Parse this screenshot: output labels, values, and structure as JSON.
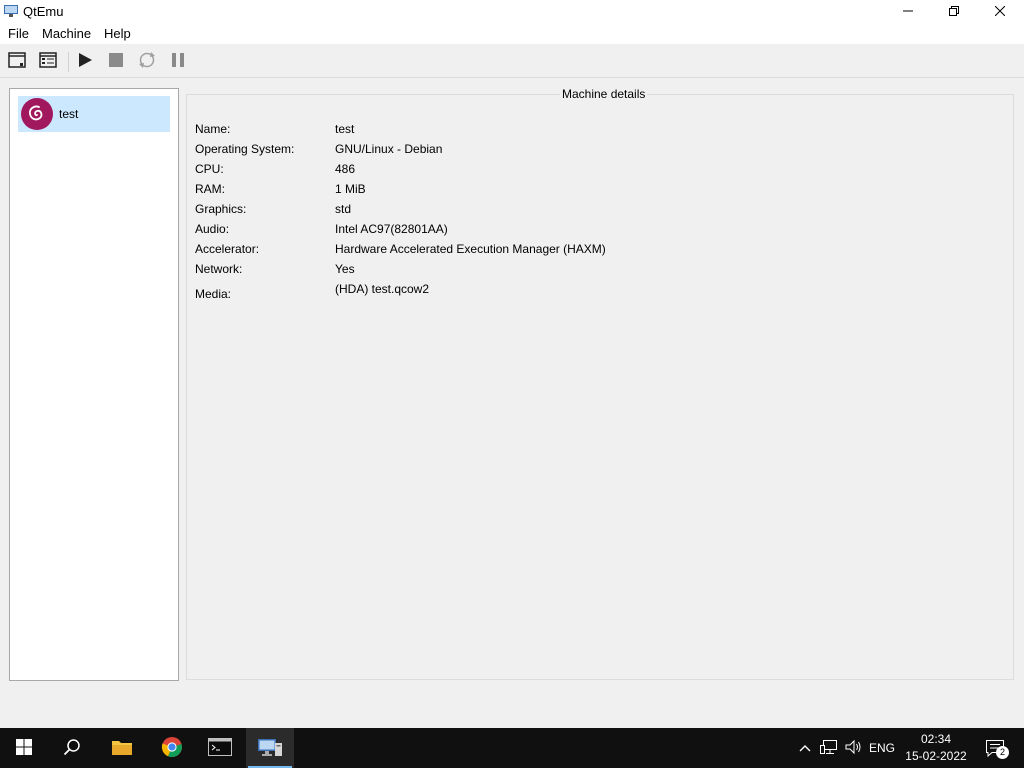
{
  "window": {
    "title": "QtEmu",
    "minimize_icon": "minimize-icon",
    "restore_icon": "restore-icon",
    "close_icon": "close-icon"
  },
  "menu": {
    "items": [
      "File",
      "Machine",
      "Help"
    ]
  },
  "toolbar": {
    "buttons": [
      {
        "icon": "new-machine-icon",
        "enabled": true
      },
      {
        "icon": "machine-settings-icon",
        "enabled": true
      },
      {
        "icon": "play-icon",
        "enabled": true
      },
      {
        "icon": "stop-icon",
        "enabled": false
      },
      {
        "icon": "reset-icon",
        "enabled": false
      },
      {
        "icon": "pause-icon",
        "enabled": false
      }
    ]
  },
  "machines": [
    {
      "name": "test",
      "icon": "debian-icon",
      "selected": true
    }
  ],
  "details": {
    "title": "Machine details",
    "rows": [
      {
        "label": "Name:",
        "value": "test"
      },
      {
        "label": "Operating System:",
        "value": "GNU/Linux - Debian"
      },
      {
        "label": "CPU:",
        "value": "486"
      },
      {
        "label": "RAM:",
        "value": "1 MiB"
      },
      {
        "label": "Graphics:",
        "value": "std"
      },
      {
        "label": "Audio:",
        "value": "Intel AC97(82801AA)"
      },
      {
        "label": "Accelerator:",
        "value": "Hardware Accelerated Execution Manager (HAXM)"
      },
      {
        "label": "Network:",
        "value": "Yes"
      },
      {
        "label": "Media:",
        "value": "(HDA) test.qcow2"
      }
    ]
  },
  "taskbar": {
    "apps": [
      "start-icon",
      "search-icon",
      "file-explorer-icon",
      "chrome-icon",
      "terminal-icon",
      "qtemu-icon"
    ],
    "tray": {
      "language": "ENG",
      "time": "02:34",
      "date": "15-02-2022",
      "notifications": "2"
    }
  },
  "colors": {
    "selection": "#cce8ff",
    "debian_swirl_bg": "#a1185f",
    "taskbar": "#101010"
  }
}
